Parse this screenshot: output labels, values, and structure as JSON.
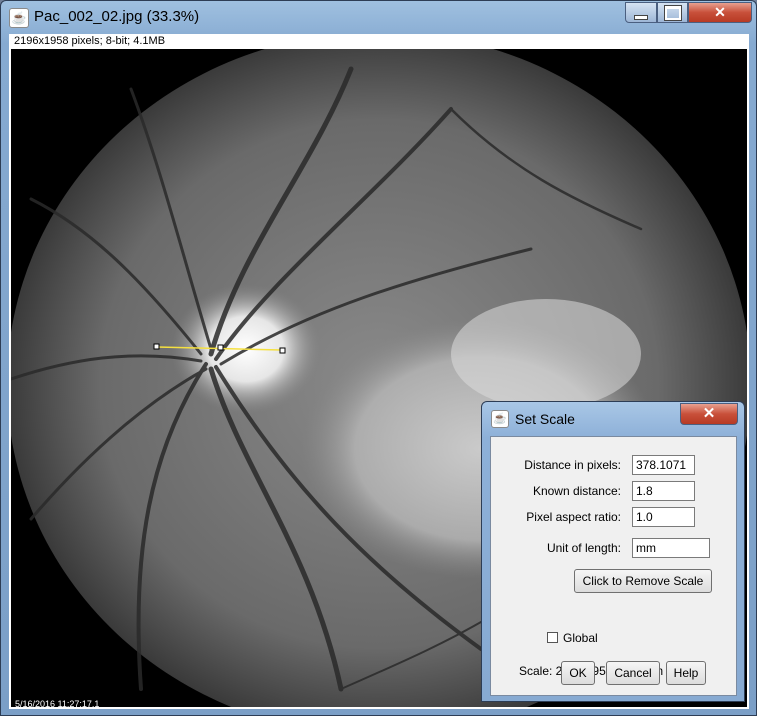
{
  "window": {
    "title": "Pac_002_02.jpg (33.3%)",
    "info": "2196x1958 pixels; 8-bit; 4.1MB",
    "timestamp": "5/16/2016  11:27:17.1",
    "close_glyph": "✕"
  },
  "dialog": {
    "title": "Set Scale",
    "close_glyph": "✕",
    "distance_label": "Distance in pixels:",
    "distance_value": "378.1071",
    "known_label": "Known distance:",
    "known_value": "1.8",
    "aspect_label": "Pixel aspect ratio:",
    "aspect_value": "1.0",
    "unit_label": "Unit of length:",
    "unit_value": "mm",
    "remove_scale_label": "Click to Remove Scale",
    "global_label": "Global",
    "global_checked": false,
    "scale_text": "Scale: 210.0595 pixels/mm",
    "ok_label": "OK",
    "cancel_label": "Cancel",
    "help_label": "Help"
  },
  "colors": {
    "measure_line": "#f5e040",
    "title_bar": "#86aad1",
    "close_button": "#c8503a"
  },
  "icons": [
    "java-coffee-icon",
    "minimize-icon",
    "maximize-icon",
    "close-icon"
  ]
}
